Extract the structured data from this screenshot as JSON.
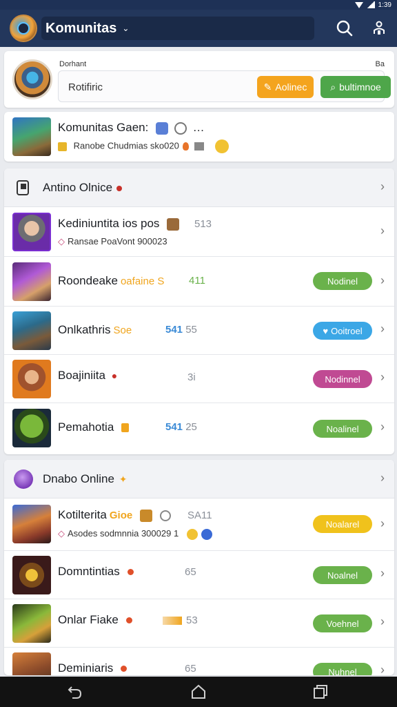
{
  "app": {
    "title": "Komunitas"
  },
  "status": {
    "time": "1:39"
  },
  "profile": {
    "label": "Dorhant",
    "label_right": "Ba",
    "input_value": "Rotifiric",
    "button_primary": "Aolinec",
    "button_secondary": "bultimnoe"
  },
  "featured": {
    "title": "Komunitas Gaen:",
    "subtitle": "Ranobe Chudmias sko020"
  },
  "group1": {
    "title": "Antino Olnice",
    "rows": [
      {
        "title": "Kediniuntita ios pos",
        "count": "513",
        "subtitle": "Ransae PoaVont 900023"
      },
      {
        "title": "Roondeake",
        "accent": "oafaine S",
        "count": "411",
        "pill": "Nodinel"
      },
      {
        "title": "Onlkathris",
        "accent": "Soe",
        "count_blue": "541",
        "count": "55",
        "pill": "Ooitroel"
      },
      {
        "title": "Boajiniita",
        "count": "3i",
        "pill": "Nodinnel"
      },
      {
        "title": "Pemahotia",
        "count_blue": "541",
        "count": "25",
        "pill": "Noalinel"
      }
    ]
  },
  "group2": {
    "title": "Dnabo Online",
    "rows": [
      {
        "title": "Kotilterita",
        "accent": "Gioe",
        "count": "SA11",
        "subtitle": "Asodes sodmnnia 300029 1",
        "pill": "Noalarel"
      },
      {
        "title": "Domntintias",
        "count": "65",
        "pill": "Noalnel"
      },
      {
        "title": "Onlar Fiake",
        "count": "53",
        "pill": "Voehnel"
      },
      {
        "title": "Deminiaris",
        "count": "65",
        "pill": "Nuhnel"
      }
    ]
  },
  "colors": {
    "appbar": "#23375c",
    "pill_green": "#6ab24b",
    "pill_blue": "#3ba7e6",
    "pill_magenta": "#c04a93",
    "pill_yellow": "#f0c21c",
    "button_orange": "#f4a41e",
    "button_green": "#4ea64a"
  },
  "icons": {
    "search": "search-icon",
    "settings": "settings-icon",
    "back": "back-icon",
    "home": "home-icon",
    "recents": "recents-icon"
  }
}
